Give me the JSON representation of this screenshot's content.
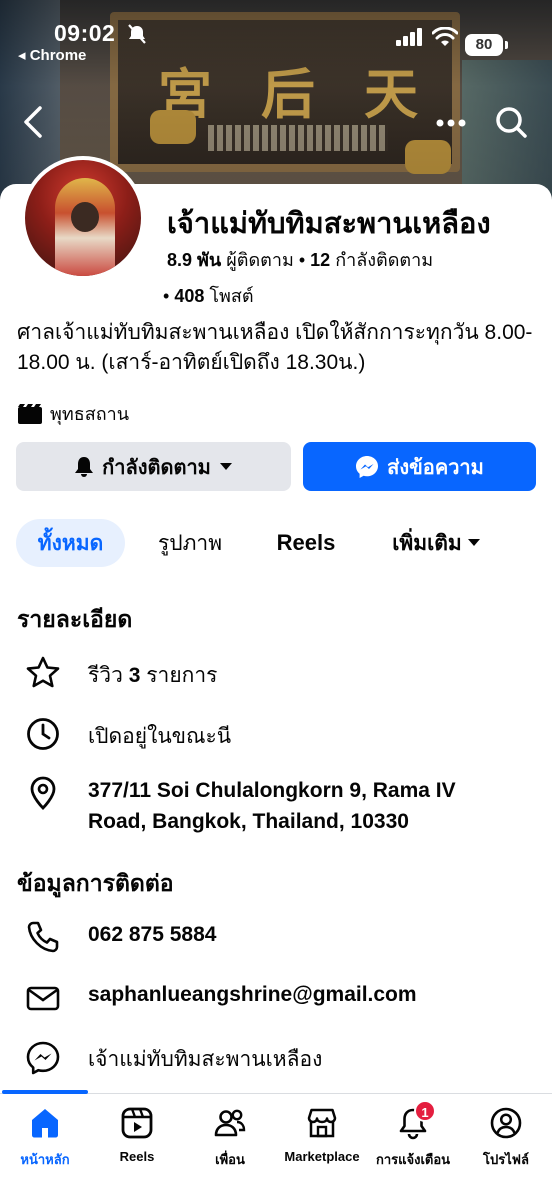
{
  "status_bar": {
    "time": "09:02",
    "back_app": "◂ Chrome",
    "battery": "80"
  },
  "profile": {
    "name": "เจ้าแม่ทับทิมสะพานเหลือง",
    "followers_count": "8.9 พัน",
    "followers_label": "ผู้ติดตาม",
    "following_count": "12",
    "following_label": "กำลังติดตาม",
    "posts_count": "408",
    "posts_label": "โพสต์",
    "bio": "ศาลเจ้าแม่ทับทิมสะพานเหลือง เปิดให้สักการะทุกวัน 8.00-18.00 น. (เสาร์-อาทิตย์เปิดถึง 18.30น.)",
    "category": "พุทธสถาน"
  },
  "actions": {
    "follow_label": "กำลังติดตาม",
    "message_label": "ส่งข้อความ"
  },
  "tabs": {
    "all": "ทั้งหมด",
    "photos": "รูปภาพ",
    "reels": "Reels",
    "more": "เพิ่มเติม"
  },
  "details": {
    "title": "รายละเอียด",
    "reviews_prefix": "รีวิว",
    "reviews_count": "3",
    "reviews_suffix": "รายการ",
    "hours": "เปิดอยู่ในขณะนี",
    "address_line1": "377/11 Soi Chulalongkorn 9, Rama IV",
    "address_line2": "Road, Bangkok, Thailand, 10330"
  },
  "contact": {
    "title": "ข้อมูลการติดต่อ",
    "phone": "062 875 5884",
    "email": "saphanlueangshrine@gmail.com",
    "messenger": "เจ้าแม่ทับทิมสะพานเหลือง"
  },
  "bottom_nav": {
    "home": "หน้าหลัก",
    "reels": "Reels",
    "friends": "เพื่อน",
    "marketplace": "Marketplace",
    "notifications": "การแจ้งเตือน",
    "notifications_badge": "1",
    "profile": "โปรไฟล์"
  },
  "colors": {
    "accent": "#0866ff",
    "accent_light": "#e7f0fe",
    "button_gray": "#e4e6eb",
    "badge_red": "#e41e3f"
  },
  "cover_text": "宮后天"
}
